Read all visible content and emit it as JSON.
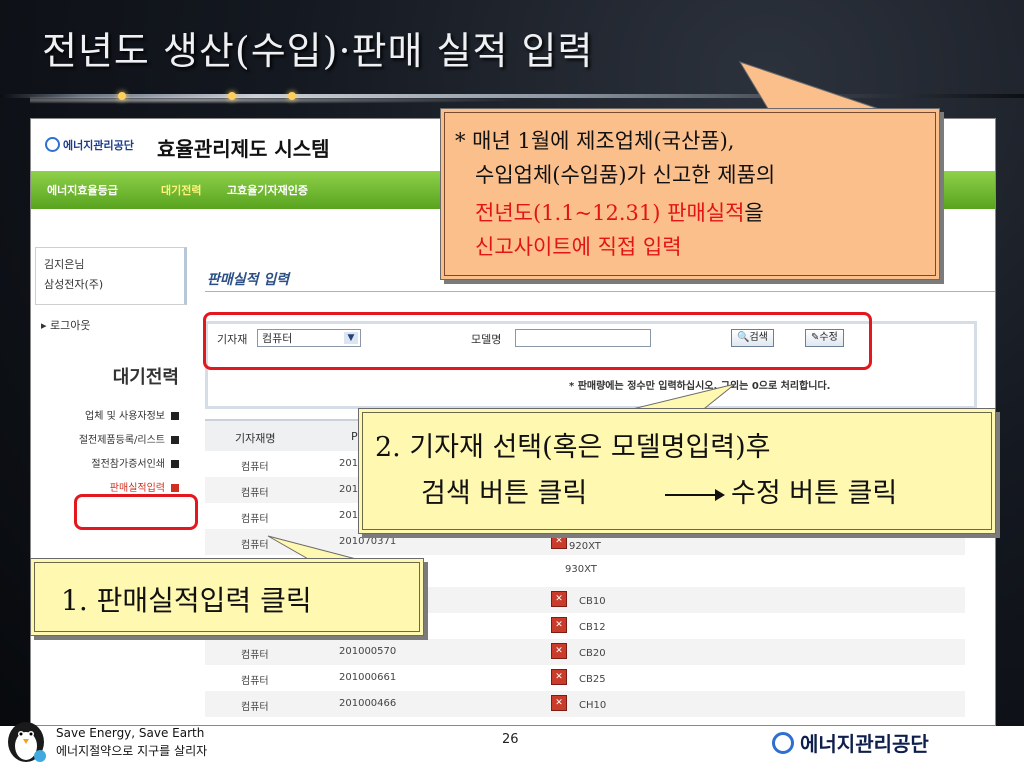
{
  "slide": {
    "title": "전년도 생산(수입)·판매 실적 입력",
    "page_number": "26",
    "footer_line1": "Save Energy, Save Earth",
    "footer_line2": "에너지절약으로 지구를 살리자",
    "footer_logo": "에너지관리공단"
  },
  "site": {
    "agency_logo": "에너지관리공단",
    "system_name": "효율관리제도 시스템",
    "nav": [
      "에너지효율등급",
      "대기전력",
      "고효율기자재인증"
    ],
    "user_name": "김지은님",
    "user_company": "삼성전자(주)",
    "logout": "로그아웃",
    "menu_title": "대기전력",
    "menu": [
      "업체 및 사용자정보",
      "절전제품등록/리스트",
      "절전참가증서인쇄",
      "판매실적입력"
    ],
    "page_title": "판매실적 입력",
    "search": {
      "equipment_label": "기자재",
      "equipment_value": "컴퓨터",
      "model_label": "모델명",
      "search_button": "검색",
      "edit_button": "수정",
      "note": "* 판매량에는 정수만 입력하십시오. 그외는 0으로 처리합니다."
    },
    "table": {
      "headers": [
        "기자재명",
        "P"
      ],
      "rows": [
        {
          "name": "컴퓨터",
          "code": "2010",
          "model": ""
        },
        {
          "name": "컴퓨터",
          "code": "2010",
          "model": ""
        },
        {
          "name": "컴퓨터",
          "code": "2010",
          "model": ""
        },
        {
          "name": "컴퓨터",
          "code": "201070371",
          "model": "920XT"
        },
        {
          "name": "",
          "code": "",
          "model": "930XT"
        },
        {
          "name": "",
          "code": "",
          "model": "CB10"
        },
        {
          "name": "",
          "code": "",
          "model": "CB12"
        },
        {
          "name": "컴퓨터",
          "code": "201000570",
          "model": "CB20"
        },
        {
          "name": "컴퓨터",
          "code": "201000661",
          "model": "CB25"
        },
        {
          "name": "컴퓨터",
          "code": "201000466",
          "model": "CH10"
        }
      ]
    }
  },
  "callouts": {
    "top": {
      "line1": "* 매년 1월에 제조업체(국산품),",
      "line2": "수입업체(수입품)가 신고한 제품의",
      "line3_red": "전년도(1.1~12.31) 판매실적",
      "line3_black": "을",
      "line4": "신고사이트에 직접 입력"
    },
    "middle": {
      "line1": "2. 기자재 선택(혹은 모델명입력)후",
      "line2a": "검색 버튼 클릭",
      "line2b": "수정 버튼 클릭"
    },
    "bottom": {
      "text": "1. 판매실적입력 클릭"
    }
  },
  "colors": {
    "highlight": "#e3171c",
    "nav_green": "#6cb42c",
    "callout_orange": "#fbbf8c",
    "callout_yellow": "#fff8b0"
  }
}
